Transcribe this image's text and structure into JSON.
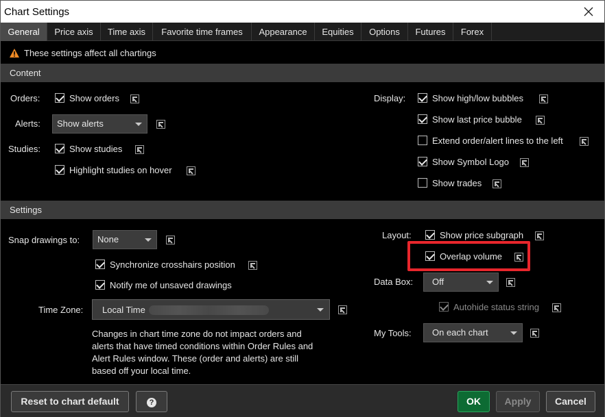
{
  "window": {
    "title": "Chart Settings"
  },
  "tabs": [
    {
      "label": "General",
      "active": true
    },
    {
      "label": "Price axis"
    },
    {
      "label": "Time axis"
    },
    {
      "label": "Favorite time frames"
    },
    {
      "label": "Appearance"
    },
    {
      "label": "Equities"
    },
    {
      "label": "Options"
    },
    {
      "label": "Futures"
    },
    {
      "label": "Forex"
    }
  ],
  "warning": {
    "text": "These settings affect all chartings"
  },
  "content": {
    "header": "Content",
    "orders_label": "Orders:",
    "show_orders": {
      "label": "Show orders",
      "checked": true
    },
    "alerts_label": "Alerts:",
    "alerts_dropdown": "Show alerts",
    "studies_label": "Studies:",
    "show_studies": {
      "label": "Show studies",
      "checked": true
    },
    "highlight_studies": {
      "label": "Highlight studies on hover",
      "checked": true
    },
    "display_label": "Display:",
    "display_options": [
      {
        "label": "Show high/low bubbles",
        "checked": true
      },
      {
        "label": "Show last price bubble",
        "checked": true
      },
      {
        "label": "Extend order/alert lines to the left",
        "checked": false
      },
      {
        "label": "Show Symbol Logo",
        "checked": true
      },
      {
        "label": "Show trades",
        "checked": false
      }
    ]
  },
  "settings": {
    "header": "Settings",
    "snap_label": "Snap drawings to:",
    "snap_value": "None",
    "sync_crosshairs": {
      "label": "Synchronize crosshairs position",
      "checked": true
    },
    "notify_unsaved": {
      "label": "Notify me of unsaved drawings",
      "checked": true
    },
    "timezone_label": "Time Zone:",
    "timezone_value": "Local Time",
    "timezone_note": "Changes in chart time zone do not impact orders and alerts that have timed conditions within Order Rules and Alert Rules window. These (order and alerts) are still based off your local time.",
    "layout_label": "Layout:",
    "show_price_subgraph": {
      "label": "Show price subgraph",
      "checked": true
    },
    "overlap_volume": {
      "label": "Overlap volume",
      "checked": true
    },
    "databox_label": "Data Box:",
    "databox_value": "Off",
    "autohide": {
      "label": "Autohide status string",
      "checked": true,
      "disabled": true
    },
    "mytools_label": "My Tools:",
    "mytools_value": "On each chart"
  },
  "footer": {
    "reset_label": "Reset to chart default",
    "help_glyph": "?",
    "ok_label": "OK",
    "apply_label": "Apply",
    "cancel_label": "Cancel"
  },
  "colors": {
    "highlight": "#e8262c",
    "ok_button": "#0d6b33",
    "warning": "#f08a24"
  }
}
